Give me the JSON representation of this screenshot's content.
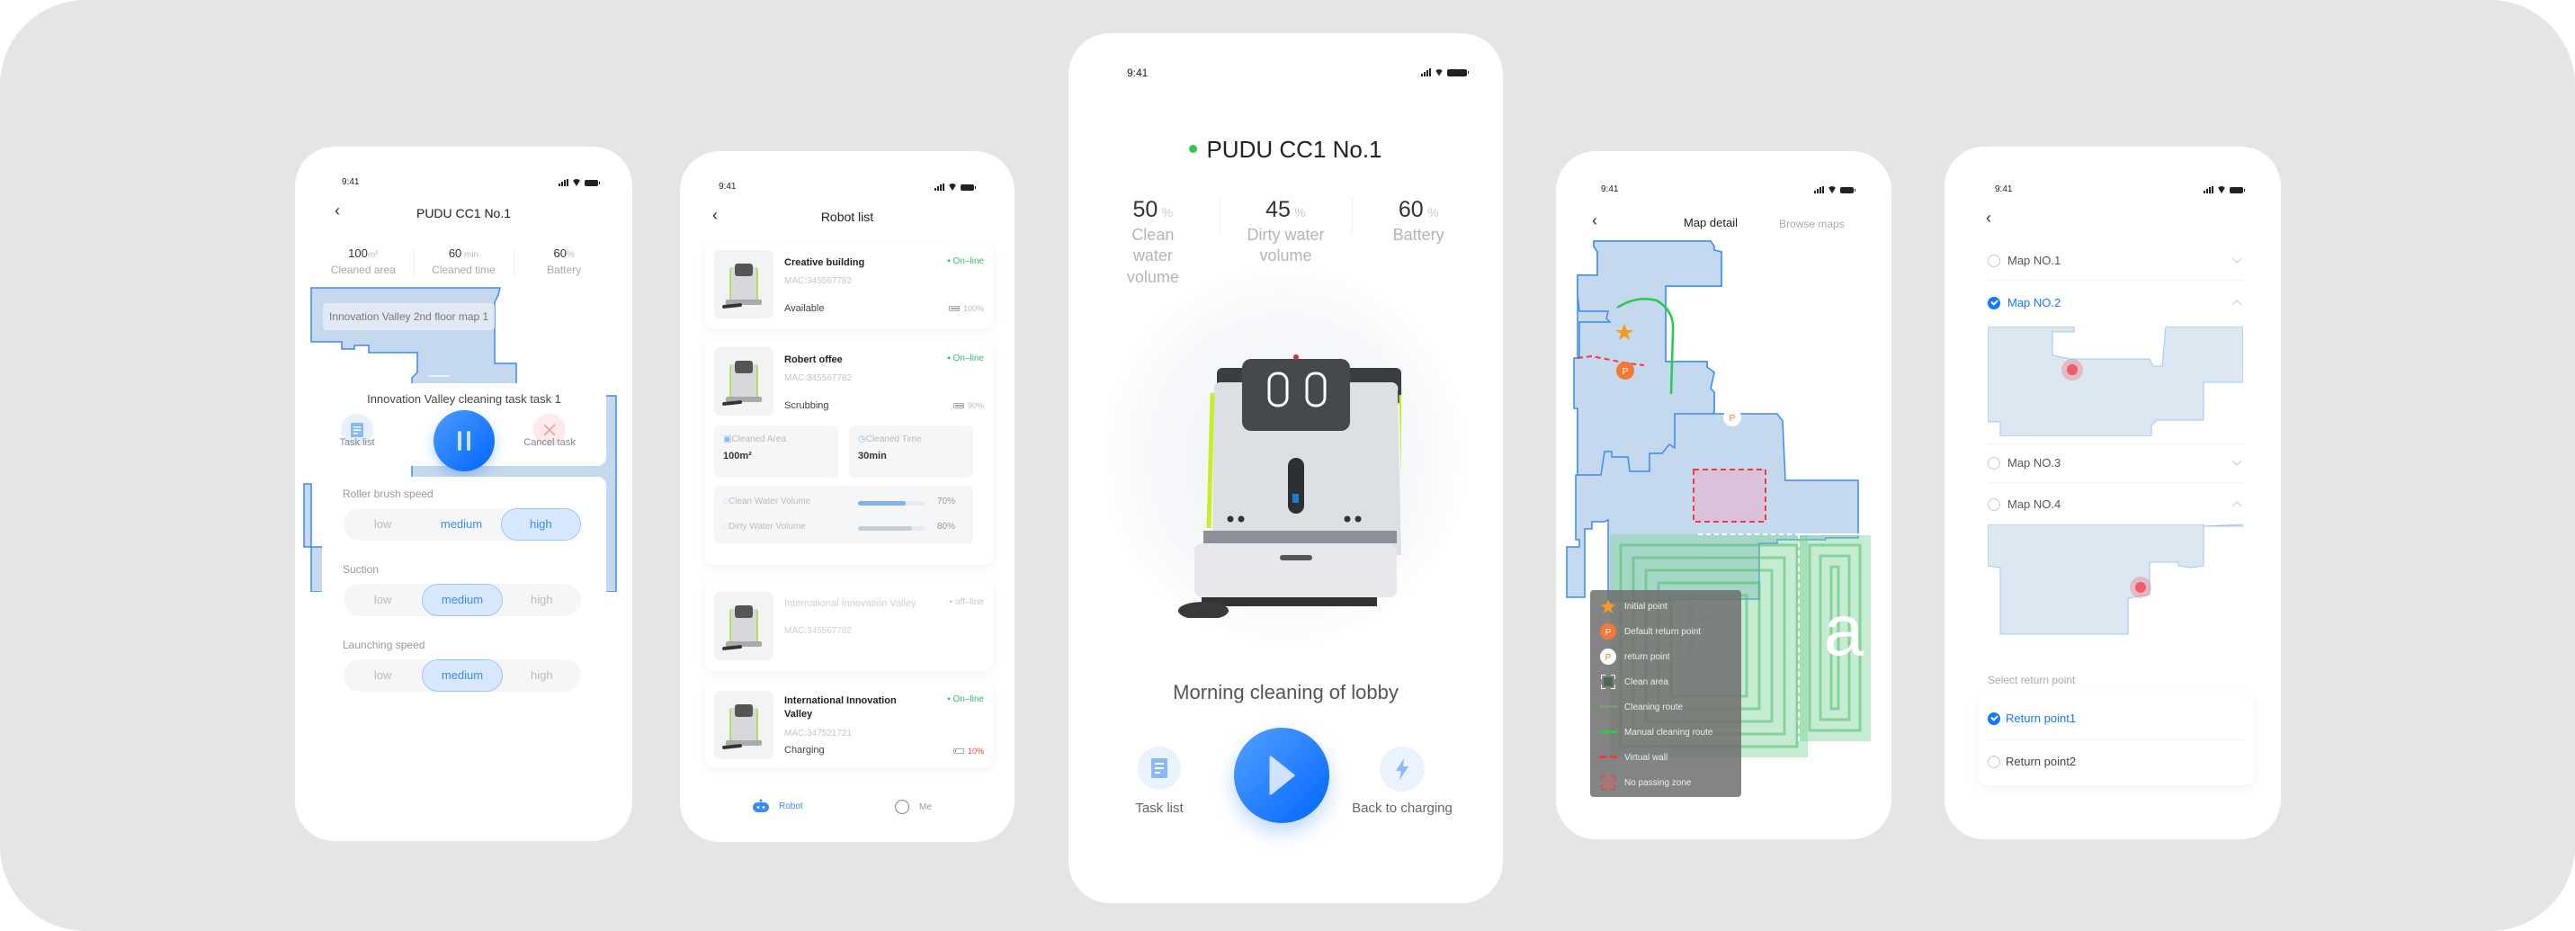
{
  "colors": {
    "accent": "#1677ff",
    "online": "#2fc25b",
    "map_fill": "#c4d9ee",
    "map_border": "#3b8bf5",
    "clean_area": "#7fd49a",
    "virtual_wall": "#f23b3b",
    "low_battery": "#f23b3b",
    "return_point": "#f47a33",
    "background": "#e5e5e5"
  },
  "status_bar": {
    "time": "9:41"
  },
  "screen1": {
    "title": "PUDU CC1  No.1",
    "back_icon": "chevron-left-icon",
    "stats": [
      {
        "value": "100",
        "unit": "m²",
        "label": "Cleaned area"
      },
      {
        "value": "60",
        "unit": " min",
        "label": "Cleaned time"
      },
      {
        "value": "60",
        "unit": "%",
        "label": "Battery"
      }
    ],
    "map_label": "Innovation Valley 2nd floor map 1",
    "task": {
      "name": "Innovation Valley cleaning task task 1",
      "task_list_label": "Task list",
      "cancel_label": "Cancel task",
      "pause_icon": "pause-icon"
    },
    "settings": [
      {
        "label": "Roller brush speed",
        "options": [
          "low",
          "medium",
          "high"
        ],
        "selected": "high"
      },
      {
        "label": "Suction",
        "options": [
          "low",
          "medium",
          "high"
        ],
        "selected": "medium"
      },
      {
        "label": "Launching speed",
        "options": [
          "low",
          "medium",
          "high"
        ],
        "selected": "medium"
      }
    ]
  },
  "screen2": {
    "title": "Robot list",
    "robots": [
      {
        "name": "Creative building",
        "mac": "MAC:345567782",
        "state": "Available",
        "status": "On–line",
        "battery": "100%",
        "battery_level": 1.0
      },
      {
        "name": "Robert offee",
        "mac": "MAC:345567782",
        "state": "Scrubbing",
        "status": "On–line",
        "battery": "90%",
        "battery_level": 0.9,
        "details": {
          "cleaned_area_label": "Cleaned Area",
          "cleaned_area": "100m²",
          "cleaned_time_label": "Cleaned Time",
          "cleaned_time": "30min",
          "clean_water_label": "Clean Water Volume",
          "clean_water": "70%",
          "clean_water_level": 0.7,
          "dirty_water_label": "Dirty Water Volume",
          "dirty_water": "80%",
          "dirty_water_level": 0.8
        }
      },
      {
        "name": "International Innovation Valley",
        "mac": "MAC:345567782",
        "state": "",
        "status": "off–line",
        "battery": ""
      },
      {
        "name": "International Innovation Valley",
        "mac": "MAC:347521721",
        "state": "Charging",
        "status": "On–line",
        "battery": "10%",
        "battery_level": 0.1
      }
    ],
    "tabs": [
      {
        "label": "Robot",
        "icon": "robot-icon",
        "active": true
      },
      {
        "label": "Me",
        "icon": "user-circle-icon",
        "active": false
      }
    ]
  },
  "screen3": {
    "robot_name": "PUDU CC1 No.1",
    "stats": [
      {
        "value": "50",
        "unit": "%",
        "label": "Clean water volume"
      },
      {
        "value": "45",
        "unit": "%",
        "label": "Dirty water volume"
      },
      {
        "value": "60",
        "unit": "%",
        "label": "Battery"
      }
    ],
    "task_name": "Morning cleaning of lobby",
    "task_list_label": "Task list",
    "back_to_charging_label": "Back to charging",
    "play_icon": "play-icon"
  },
  "screen4": {
    "title": "Map detail",
    "browse_label": "Browse maps",
    "area_labels": [
      "b",
      "a"
    ],
    "legend": [
      {
        "icon": "star-icon",
        "label": "Initial point"
      },
      {
        "icon": "default-return-point-icon",
        "label": "Default return point"
      },
      {
        "icon": "return-point-icon",
        "label": "return point"
      },
      {
        "icon": "clean-area-icon",
        "label": "Clean area"
      },
      {
        "icon": "cleaning-route-icon",
        "label": "Cleaning route"
      },
      {
        "icon": "manual-route-icon",
        "label": "Manual cleaning route"
      },
      {
        "icon": "virtual-wall-icon",
        "label": "Virtual wall"
      },
      {
        "icon": "no-passing-zone-icon",
        "label": "No passing zone"
      }
    ],
    "marker_letter": "P"
  },
  "screen5": {
    "maps": [
      {
        "name": "Map NO.1",
        "selected": false,
        "expanded": false
      },
      {
        "name": "Map NO.2",
        "selected": true,
        "expanded": true
      },
      {
        "name": "Map NO.3",
        "selected": false,
        "expanded": false
      },
      {
        "name": "Map NO.4",
        "selected": false,
        "expanded": true
      }
    ],
    "return_label": "Select return point",
    "return_points": [
      {
        "name": "Return point1",
        "selected": true
      },
      {
        "name": "Return point2",
        "selected": false
      }
    ]
  }
}
